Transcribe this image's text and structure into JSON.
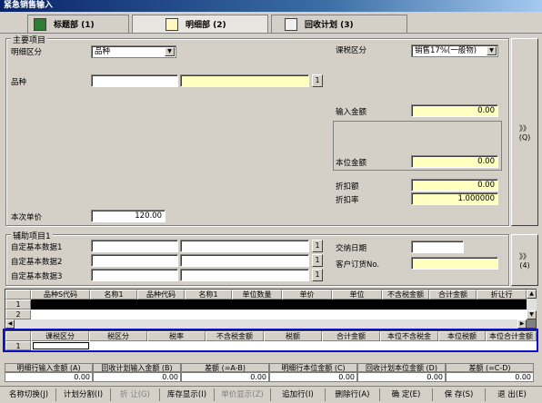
{
  "window": {
    "title": "紧急销售输入"
  },
  "tabs": [
    {
      "label": "标题部 (1)"
    },
    {
      "label": "明细部 (2)"
    },
    {
      "label": "回收计划 (3)"
    }
  ],
  "main": {
    "group_title": "主要项目",
    "detail_type_label": "明细区分",
    "detail_type_value": "品种",
    "tax_type_label": "课税区分",
    "tax_type_value": "销售17%(一般物)",
    "product_label": "品种",
    "product_code": "",
    "product_name": "",
    "lookup_btn": "1",
    "input_amount_label": "输入金额",
    "input_amount_value": "0.00",
    "local_amount_label": "本位金额",
    "local_amount_value": "0.00",
    "discount_amount_label": "折扣额",
    "discount_amount_value": "0.00",
    "discount_rate_label": "折扣率",
    "discount_rate_value": "1.000000",
    "unit_price_label": "本次单价",
    "unit_price_value": "120.00",
    "side_btn": "》》",
    "side_btn_key": "(Q)"
  },
  "aux": {
    "group_title": "辅助项目1",
    "custom1_label": "自定基本数据1",
    "custom2_label": "自定基本数据2",
    "custom3_label": "自定基本数据3",
    "delivery_date_label": "交纳日期",
    "customer_order_label": "客户订货No.",
    "lookup_btn": "1",
    "side_btn": "》》",
    "side_btn_key": "(4)"
  },
  "grid1": {
    "headers": [
      "品种S代码",
      "名称1",
      "品种代码",
      "名称1",
      "单位数量",
      "单价",
      "单位",
      "不含税金额",
      "合计金额",
      "折让行"
    ],
    "rows": [
      "1",
      "2"
    ]
  },
  "grid2": {
    "headers": [
      "课税区分",
      "税区分",
      "税率",
      "不含税金额",
      "税额",
      "合计金额",
      "本位不含税金",
      "本位税额",
      "本位合计金额"
    ],
    "rows": [
      "1"
    ]
  },
  "summary": {
    "headers": [
      "明细行输入金额 (A)",
      "回收计划输入金额 (B)",
      "差额 (=A-B)",
      "明细行本位金额 (C)",
      "回收计划本位金额 (D)",
      "差额 (=C-D)"
    ],
    "values": [
      "0.00",
      "0.00",
      "0.00",
      "0.00",
      "0.00",
      "0.00"
    ]
  },
  "footer": [
    {
      "label": "名称切换(J)",
      "enabled": true
    },
    {
      "label": "计划分割(I)",
      "enabled": true
    },
    {
      "label": "折 让(G)",
      "enabled": false
    },
    {
      "label": "库存显示(I)",
      "enabled": true
    },
    {
      "label": "单价显示(Z)",
      "enabled": false
    },
    {
      "label": "追加行(I)",
      "enabled": true
    },
    {
      "label": "删除行(A)",
      "enabled": true
    },
    {
      "label": "确 定(E)",
      "enabled": true
    },
    {
      "label": "保 存(S)",
      "enabled": true
    },
    {
      "label": "退 出(E)",
      "enabled": true
    }
  ],
  "colors": {
    "highlight_border": "#1010c8",
    "yellow_field": "#ffffc0",
    "title_bar": "#0a246a"
  }
}
